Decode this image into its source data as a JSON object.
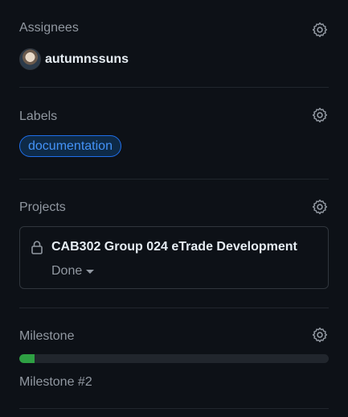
{
  "assignees": {
    "title": "Assignees",
    "users": [
      {
        "login": "autumnssuns"
      }
    ]
  },
  "labels": {
    "title": "Labels",
    "items": [
      {
        "name": "documentation",
        "color": "#4493f8"
      }
    ]
  },
  "projects": {
    "title": "Projects",
    "items": [
      {
        "name": "CAB302 Group 024 eTrade Development",
        "status": "Done"
      }
    ]
  },
  "milestone": {
    "title": "Milestone",
    "name": "Milestone #2",
    "progress_fraction": 0.05
  },
  "icons": {
    "settings": "gear-icon",
    "private_project": "lock-icon",
    "dropdown": "triangle-down-icon"
  },
  "colors": {
    "background": "#0d1117",
    "muted_text": "#9198a1",
    "label_accent": "#4493f8",
    "progress_fill": "#2ea043"
  }
}
